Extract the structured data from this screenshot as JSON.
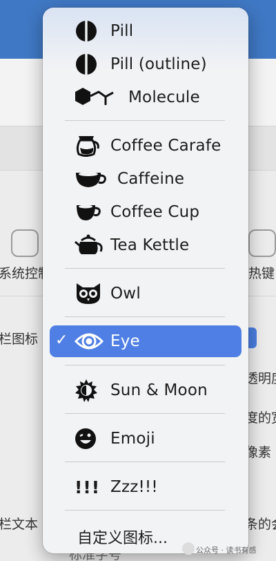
{
  "menu": {
    "items": [
      {
        "label": "Pill",
        "icon": "pill-icon"
      },
      {
        "label": "Pill (outline)",
        "icon": "pill-outline-icon"
      },
      {
        "label": "Molecule",
        "icon": "molecule-icon"
      },
      {
        "label": "Coffee Carafe",
        "icon": "coffee-carafe-icon"
      },
      {
        "label": "Caffeine",
        "icon": "caffeine-icon"
      },
      {
        "label": "Coffee Cup",
        "icon": "coffee-cup-icon"
      },
      {
        "label": "Tea Kettle",
        "icon": "tea-kettle-icon"
      },
      {
        "label": "Owl",
        "icon": "owl-icon"
      },
      {
        "label": "Eye",
        "icon": "eye-icon",
        "selected": true
      },
      {
        "label": "Sun & Moon",
        "icon": "sun-moon-icon"
      },
      {
        "label": "Emoji",
        "icon": "emoji-icon"
      },
      {
        "label": "Zzz!!!",
        "icon": "exclamation-icon",
        "prefix": "!!!"
      }
    ],
    "custom_icon_label": "自定义图标...",
    "check_mark": "✓"
  },
  "background": {
    "system_control_label": "系统控制",
    "hotkey_label": "热键",
    "menubar_icon_label": "栏图标",
    "menubar_text_label": "栏文本",
    "transparency_fragment": "透明度",
    "width_fragment": "度的宽",
    "pixel_fragment": "像素",
    "bottom_right_fragment": "条的会",
    "field_value": "标准字号",
    "accent_color": "#4f7fe4"
  },
  "watermark": "公众号 · 读书有感"
}
